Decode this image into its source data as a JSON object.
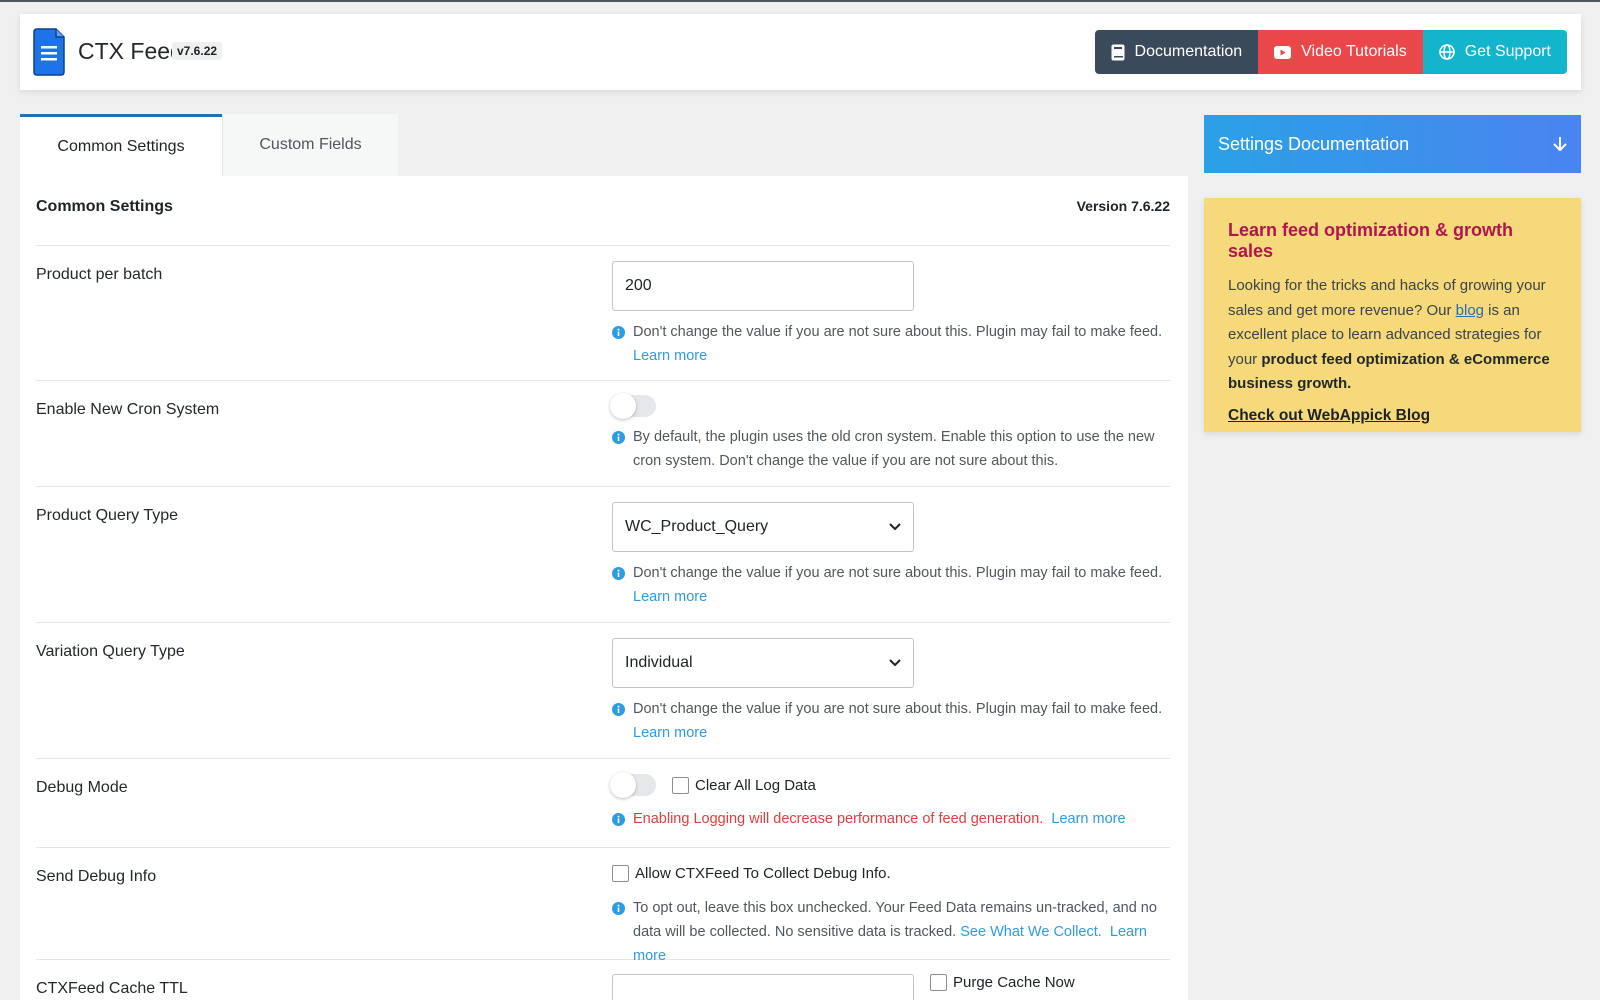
{
  "header": {
    "brand": "CTX Feed",
    "version_badge": "v7.6.22",
    "buttons": {
      "documentation": "Documentation",
      "video_tutorials": "Video Tutorials",
      "get_support": "Get Support"
    },
    "colors": {
      "documentation": "#3b4a5a",
      "video_tutorials": "#e9474a",
      "get_support": "#12b5cb"
    }
  },
  "tabs": [
    {
      "label": "Common Settings",
      "active": true
    },
    {
      "label": "Custom Fields",
      "active": false
    }
  ],
  "panel": {
    "title": "Common Settings",
    "version": "Version 7.6.22"
  },
  "settings": {
    "product_per_batch": {
      "label": "Product per batch",
      "value": "200",
      "help": "Don't change the value if you are not sure about this. Plugin may fail to make feed.",
      "help_link": "Learn more"
    },
    "cron": {
      "label": "Enable New Cron System",
      "enabled": false,
      "help": "By default, the plugin uses the old cron system. Enable this option to use the new cron system. Don't change the value if you are not sure about this."
    },
    "query_type": {
      "label": "Product Query Type",
      "value": "WC_Product_Query",
      "help": "Don't change the value if you are not sure about this. Plugin may fail to make feed.",
      "help_link": "Learn more"
    },
    "variation_query": {
      "label": "Variation Query Type",
      "value": "Individual",
      "help": "Don't change the value if you are not sure about this. Plugin may fail to make feed.",
      "help_link": "Learn more"
    },
    "debug": {
      "label": "Debug Mode",
      "enabled": false,
      "clear_log_label": "Clear All Log Data",
      "warning": "Enabling Logging will decrease performance of feed generation.",
      "help_link": "Learn more"
    },
    "send_debug": {
      "label": "Send Debug Info",
      "checkbox_label": "Allow CTXFeed To Collect Debug Info.",
      "help": "To opt out, leave this box unchecked. Your Feed Data remains un-tracked, and no data will be collected. No sensitive data is tracked.",
      "see_link": "See What We Collect.",
      "help_link": "Learn more"
    },
    "cache_ttl": {
      "label": "CTXFeed Cache TTL",
      "purge_label": "Purge Cache Now"
    }
  },
  "sidebar": {
    "doc_title": "Settings Documentation",
    "promo": {
      "title": "Learn feed optimization & growth sales",
      "text_1": "Looking for the tricks and hacks of growing your sales and get more revenue? Our ",
      "blog_link": "blog",
      "text_2": " is an excellent place to learn advanced strategies for your ",
      "text_bold": "product feed optimization & eCommerce business growth.",
      "cta": "Check out WebAppick Blog"
    }
  }
}
